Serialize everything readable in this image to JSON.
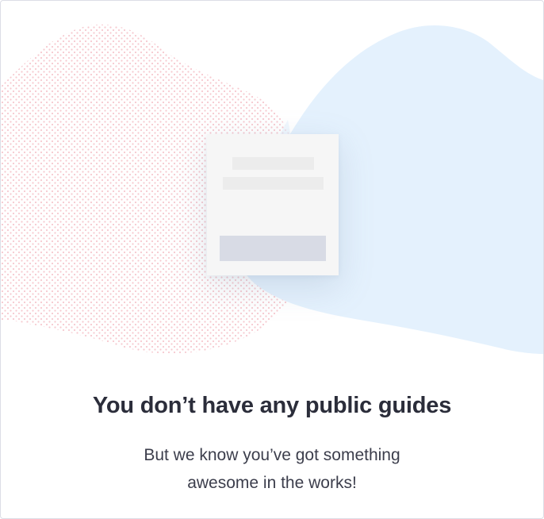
{
  "empty_state": {
    "title": "You don’t have any public guides",
    "message": "But we know you’ve got something awesome in the works!"
  },
  "illustration": {
    "icon": "guide-placeholder-icon",
    "colors": {
      "dots": "#f6c9cf",
      "blob": "#e4f1fd",
      "card": "#f6f6f6",
      "line": "#ececec",
      "button": "#d8dbe5"
    }
  },
  "colors": {
    "title": "#2b2d3a",
    "text": "#3c3e4c",
    "border": "#dcdde6"
  }
}
